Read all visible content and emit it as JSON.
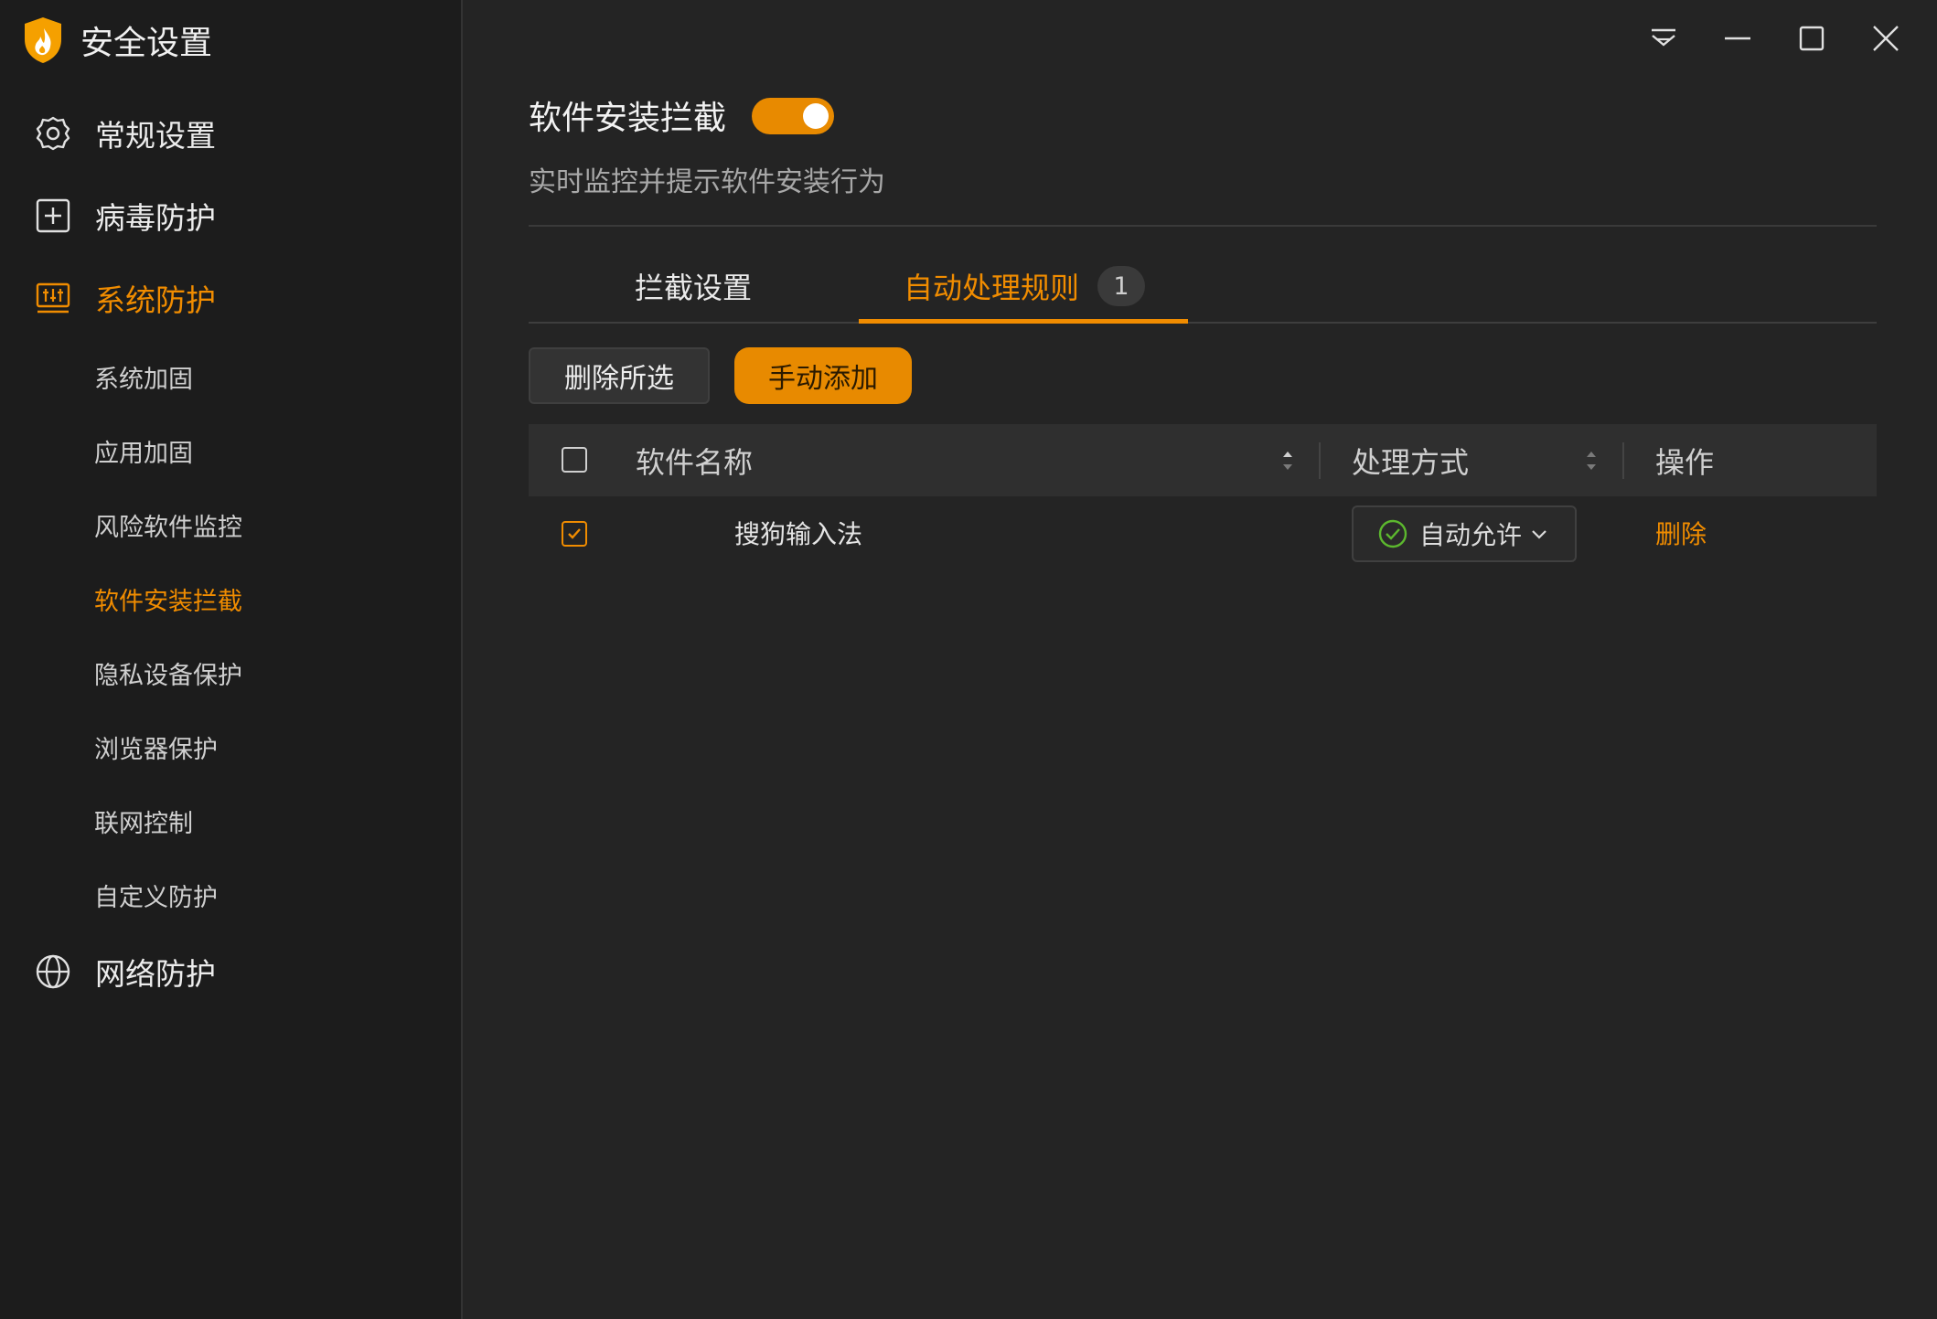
{
  "app": {
    "title": "安全设置"
  },
  "sidebar": {
    "main_items": [
      {
        "label": "常规设置",
        "icon": "gear-icon"
      },
      {
        "label": "病毒防护",
        "icon": "plus-box-icon"
      },
      {
        "label": "系统防护",
        "icon": "system-sliders-icon",
        "active": true
      },
      {
        "label": "网络防护",
        "icon": "globe-icon"
      }
    ],
    "sub_items": [
      {
        "label": "系统加固"
      },
      {
        "label": "应用加固"
      },
      {
        "label": "风险软件监控"
      },
      {
        "label": "软件安装拦截",
        "active": true
      },
      {
        "label": "隐私设备保护"
      },
      {
        "label": "浏览器保护"
      },
      {
        "label": "联网控制"
      },
      {
        "label": "自定义防护"
      }
    ]
  },
  "window_controls": [
    "menu-icon",
    "minimize-icon",
    "maximize-icon",
    "close-icon"
  ],
  "feature": {
    "title": "软件安装拦截",
    "enabled": true,
    "description": "实时监控并提示软件安装行为"
  },
  "tabs": [
    {
      "label": "拦截设置",
      "active": false
    },
    {
      "label": "自动处理规则",
      "active": true,
      "badge": "1"
    }
  ],
  "toolbar": {
    "delete_selected_label": "删除所选",
    "manual_add_label": "手动添加"
  },
  "table": {
    "headers": {
      "name": "软件名称",
      "method": "处理方式",
      "action": "操作"
    },
    "rows": [
      {
        "checked": true,
        "name": "搜狗输入法",
        "method": "自动允许",
        "action": "删除"
      }
    ]
  },
  "colors": {
    "accent": "#f08c00",
    "background": "#242424",
    "sidebar": "#1c1c1c",
    "success": "#5cb82e"
  }
}
